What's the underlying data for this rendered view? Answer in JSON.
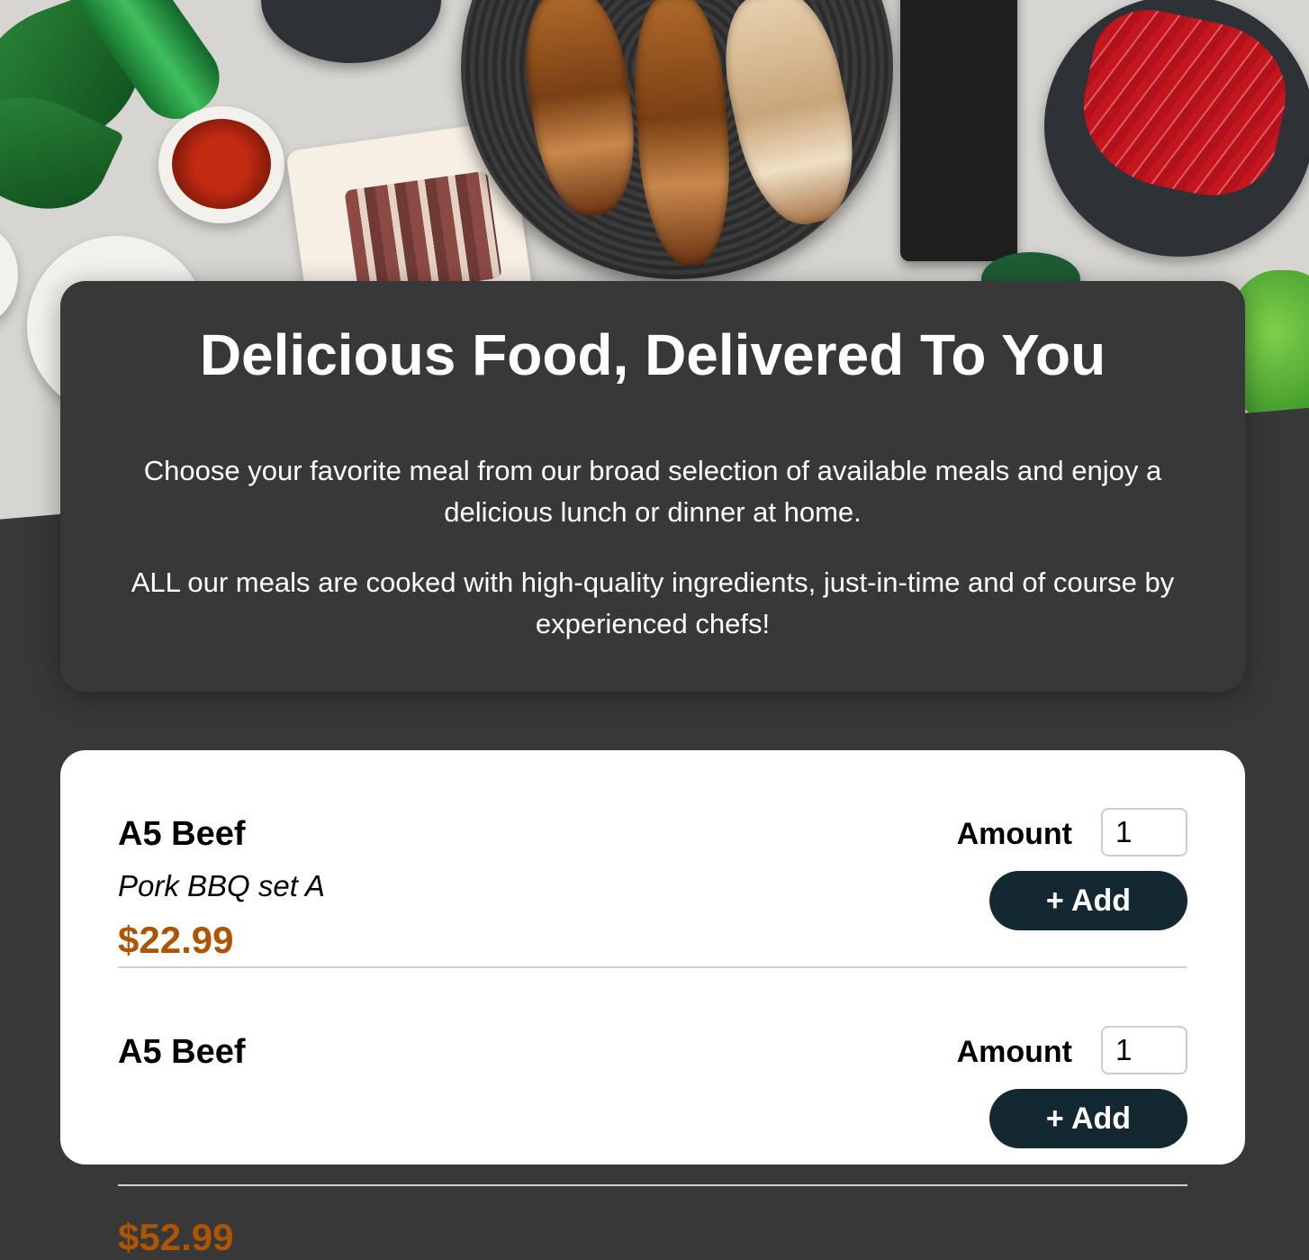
{
  "hero": {
    "image": "Korean BBQ table spread with grilled pork belly on round grill, raw beef slices, sauces and green bottle"
  },
  "summary": {
    "title": "Delicious Food, Delivered To You",
    "paragraph1": "Choose your favorite meal from our broad selection of available meals and enjoy a delicious lunch or dinner at home.",
    "paragraph2": "ALL our meals are cooked with high-quality ingredients, just-in-time and of course by experienced chefs!"
  },
  "meals": [
    {
      "name": "A5 Beef",
      "description": "Pork BBQ set A",
      "price": "$22.99",
      "amount_label": "Amount",
      "amount_value": "1",
      "add_label": "+ Add"
    },
    {
      "name": "A5 Beef",
      "description": "",
      "price": "$52.99",
      "amount_label": "Amount",
      "amount_value": "1",
      "add_label": "+ Add"
    }
  ],
  "colors": {
    "page_background": "#383838",
    "card_background": "#ffffff",
    "price": "#ad5502",
    "button": "#142832"
  }
}
